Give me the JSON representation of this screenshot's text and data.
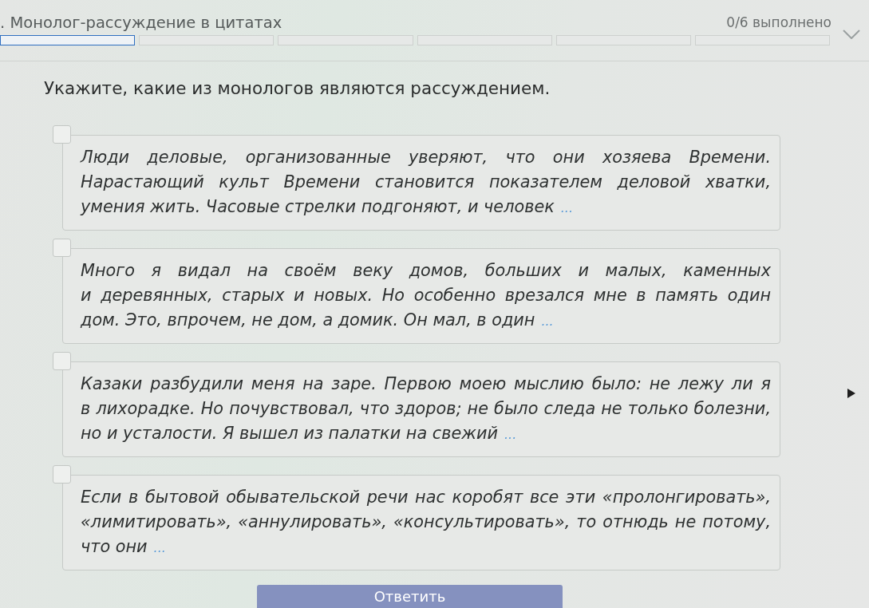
{
  "header": {
    "title": ". Монолог-рассуждение в цитатах",
    "progress_text": "0/6 выполнено",
    "steps": [
      {
        "selected": true
      },
      {
        "selected": false
      },
      {
        "selected": false
      },
      {
        "selected": false
      },
      {
        "selected": false
      },
      {
        "selected": false
      }
    ]
  },
  "question": "Укажите, какие из монологов являются рассуждением.",
  "options": [
    {
      "text": "Люди деловые, организованные уверяют, что они хозяева Времени. Нарастающий культ Времени становится показателем деловой хватки, умения жить. Часовые стрелки подгоняют, и человек",
      "more": "...",
      "checked": false
    },
    {
      "text": "Много я видал на своём веку домов, больших и малых, каменных и деревянных, старых и новых. Но особенно врезался мне в память один дом. Это, впрочем, не дом, а домик. Он мал, в один",
      "more": "...",
      "checked": false
    },
    {
      "text": "Казаки разбудили меня на заре. Первою моею мыслию было: не лежу ли я в лихорадке. Но почувствовал, что здоров; не было следа не только болезни, но и усталости. Я вышел из палатки на свежий",
      "more": "...",
      "checked": false
    },
    {
      "text": "Если в бытовой обывательской речи нас коробят все эти «пролонгировать», «лимитировать», «аннулировать», «консультировать», то отнюдь не потому, что они",
      "more": "...",
      "checked": false
    }
  ],
  "submit_button": {
    "label": "Ответить",
    "disabled": true
  }
}
